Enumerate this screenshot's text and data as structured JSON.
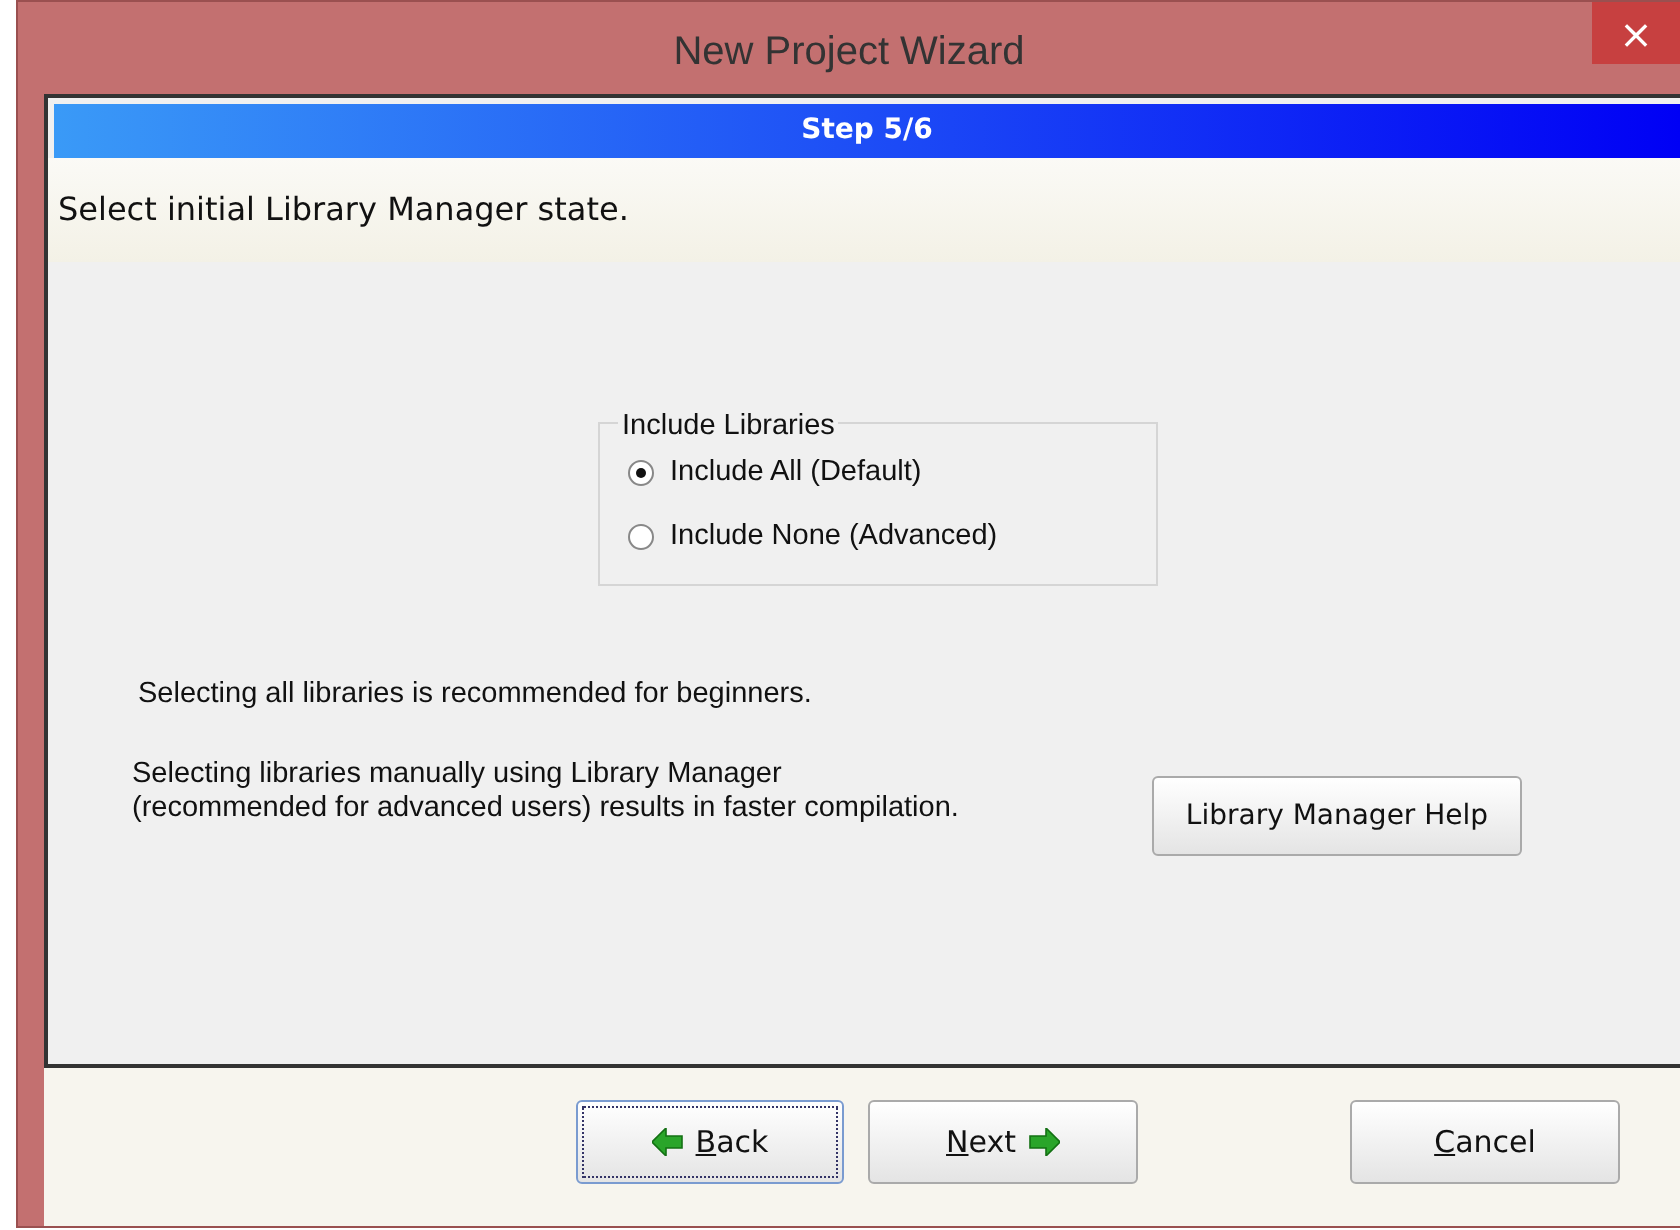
{
  "window": {
    "title": "New Project Wizard",
    "close": "×"
  },
  "step": "Step 5/6",
  "heading": "Select initial Library Manager state.",
  "group": {
    "title": "Include Libraries",
    "options": [
      {
        "label": "Include All (Default)",
        "selected": true
      },
      {
        "label": "Include None (Advanced)",
        "selected": false
      }
    ]
  },
  "notes": [
    "Selecting all libraries is recommended for beginners.",
    "Selecting libraries manually using Library Manager\n(recommended for advanced users) results in faster compilation."
  ],
  "help_button": "Library Manager Help",
  "buttons": [
    {
      "kind": "back",
      "label": "Back",
      "underline_first": true,
      "focused": true
    },
    {
      "kind": "next",
      "label": "Next",
      "underline_first": true,
      "focused": false
    },
    {
      "kind": "cancel",
      "label": "Cancel",
      "underline_first": true,
      "focused": false
    }
  ]
}
